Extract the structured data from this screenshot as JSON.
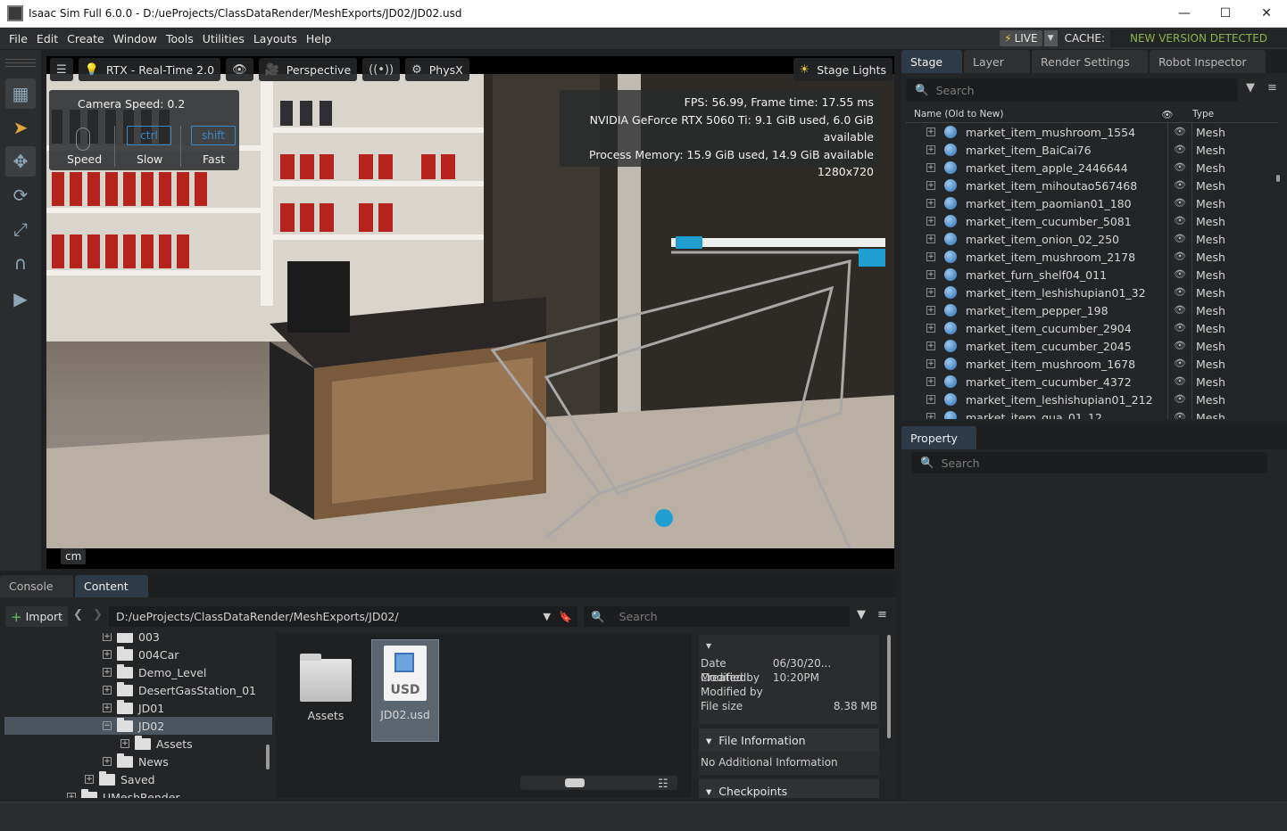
{
  "window": {
    "title": "Isaac Sim Full 6.0.0 - D:/ueProjects/ClassDataRender/MeshExports/JD02/JD02.usd",
    "minimize": "—",
    "maximize": "☐",
    "close": "✕"
  },
  "menu": {
    "items": [
      "File",
      "Edit",
      "Create",
      "Window",
      "Tools",
      "Utilities",
      "Layouts",
      "Help"
    ],
    "live_label": "LIVE",
    "cache_label": "CACHE:",
    "cache_status": "NEW VERSION DETECTED",
    "cache_status_color": "#8ab54a"
  },
  "viewport": {
    "render_mode": "RTX - Real-Time 2.0",
    "camera": "Perspective",
    "physics": "PhysX",
    "lights": "Stage Lights",
    "camera_speed_label": "Camera Speed:",
    "camera_speed_value": "0.2",
    "keys": {
      "ctrl": "ctrl",
      "shift": "shift"
    },
    "speed_labels": {
      "speed": "Speed",
      "slow": "Slow",
      "fast": "Fast"
    },
    "stats": [
      "FPS: 56.99, Frame time: 17.55 ms",
      "NVIDIA GeForce RTX 5060 Ti: 9.1 GiB used, 6.0 GiB available",
      "Process Memory: 15.9 GiB used, 14.9 GiB available",
      "1280x720"
    ],
    "units": "cm"
  },
  "stage": {
    "tabs": [
      "Stage",
      "Layer",
      "Render Settings",
      "Robot Inspector"
    ],
    "search_placeholder": "Search",
    "col_name": "Name (Old to New)",
    "col_type": "Type",
    "items": [
      {
        "name": "market_item_mushroom_1554",
        "type": "Mesh"
      },
      {
        "name": "market_item_BaiCai76",
        "type": "Mesh"
      },
      {
        "name": "market_item_apple_2446644",
        "type": "Mesh"
      },
      {
        "name": "market_item_mihoutao567468",
        "type": "Mesh"
      },
      {
        "name": "market_item_paomian01_180",
        "type": "Mesh"
      },
      {
        "name": "market_item_cucumber_5081",
        "type": "Mesh"
      },
      {
        "name": "market_item_onion_02_250",
        "type": "Mesh"
      },
      {
        "name": "market_item_mushroom_2178",
        "type": "Mesh"
      },
      {
        "name": "market_furn_shelf04_011",
        "type": "Mesh"
      },
      {
        "name": "market_item_leshishupian01_32",
        "type": "Mesh"
      },
      {
        "name": "market_item_pepper_198",
        "type": "Mesh"
      },
      {
        "name": "market_item_cucumber_2904",
        "type": "Mesh"
      },
      {
        "name": "market_item_cucumber_2045",
        "type": "Mesh"
      },
      {
        "name": "market_item_mushroom_1678",
        "type": "Mesh"
      },
      {
        "name": "market_item_cucumber_4372",
        "type": "Mesh"
      },
      {
        "name": "market_item_leshishupian01_212",
        "type": "Mesh"
      },
      {
        "name": "market_item_gua_01_12",
        "type": "Mesh"
      }
    ]
  },
  "property": {
    "tab": "Property",
    "search_placeholder": "Search"
  },
  "content": {
    "tabs": [
      "Console",
      "Content"
    ],
    "import_label": "Import",
    "path": "D:/ueProjects/ClassDataRender/MeshExports/JD02/",
    "search_placeholder": "Search",
    "folders": [
      {
        "name": "003",
        "indent": 3,
        "expand": "+"
      },
      {
        "name": "004Car",
        "indent": 3,
        "expand": "+"
      },
      {
        "name": "Demo_Level",
        "indent": 3,
        "expand": "+"
      },
      {
        "name": "DesertGasStation_01",
        "indent": 3,
        "expand": "+"
      },
      {
        "name": "JD01",
        "indent": 3,
        "expand": "+"
      },
      {
        "name": "JD02",
        "indent": 3,
        "expand": "−",
        "selected": true
      },
      {
        "name": "Assets",
        "indent": 4,
        "expand": "+"
      },
      {
        "name": "News",
        "indent": 3,
        "expand": "+"
      },
      {
        "name": "Saved",
        "indent": 2,
        "expand": "+"
      },
      {
        "name": "UMeshRender",
        "indent": 1,
        "expand": "+"
      }
    ],
    "grid": [
      {
        "name": "Assets",
        "kind": "folder"
      },
      {
        "name": "JD02.usd",
        "kind": "usd",
        "badge": "USD"
      }
    ],
    "info": {
      "date_modified_label": "Date Modified",
      "date_modified_value": "06/30/20... 10:20PM",
      "created_by_label": "Created by",
      "modified_by_label": "Modified by",
      "file_size_label": "File size",
      "file_size_value": "8.38 MB",
      "file_info_head": "File Information",
      "file_info_text": "No Additional Information",
      "checkpoints_head": "Checkpoints"
    }
  }
}
